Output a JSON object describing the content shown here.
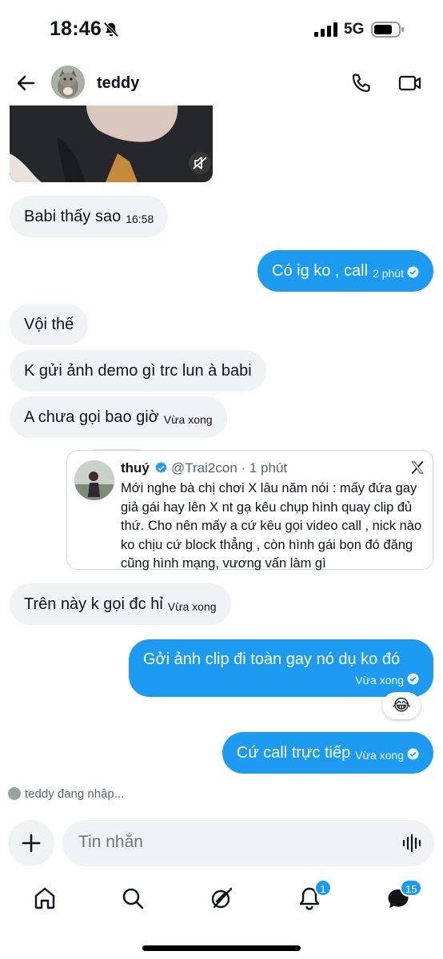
{
  "status_bar": {
    "time": "18:46",
    "network": "5G"
  },
  "header": {
    "name": "teddy"
  },
  "messages": [
    {
      "text": "Babi thấy sao",
      "time": "16:58"
    },
    {
      "text": "Có ig ko , call",
      "time": "2 phút"
    },
    {
      "text": "Vội thế"
    },
    {
      "text": "K gửi ảnh demo gì trc lun à babi"
    },
    {
      "text": "A chưa gọi bao giờ",
      "time": "Vừa xong"
    },
    {
      "text": "Trên này k gọi đc hỉ",
      "time": "Vừa xong"
    },
    {
      "text": "Gởi ảnh clip đi toàn gay nó dụ ko đó",
      "time": "Vừa xong",
      "reaction": "😂"
    },
    {
      "text": "Cứ call trực tiếp",
      "time": "Vừa xong"
    }
  ],
  "quote": {
    "name": "thuý",
    "handle": "@Trai2con · 1 phút",
    "lines": [
      "Mới nghe bà chị chơi X lâu năm nói : mấy đứa gay",
      "giả gái hay lên X nt gạ kêu chụp hình quay clip đủ",
      "thứ. Cho nên mấy a cứ kêu gọi video call , nick nào",
      "ko chịu cứ block thẳng , còn hình gái bọn đó đăng",
      "cũng hình mạng, vương vấn làm gì"
    ]
  },
  "typing": "teddy đang nhập...",
  "composer": {
    "placeholder": "Tin nhắn"
  },
  "nav": {
    "notifications_badge": "1",
    "messages_badge": "15"
  },
  "colors": {
    "accent": "#1d9bf0",
    "incoming_bubble": "#eff3f4",
    "text": "#0f1419",
    "secondary_text": "#536471"
  },
  "icons": [
    "back-arrow-icon",
    "phone-icon",
    "video-icon",
    "mute-icon",
    "verified-icon",
    "x-logo-icon",
    "plus-icon",
    "voice-icon",
    "home-icon",
    "search-icon",
    "grok-icon",
    "bell-icon",
    "messages-icon"
  ]
}
